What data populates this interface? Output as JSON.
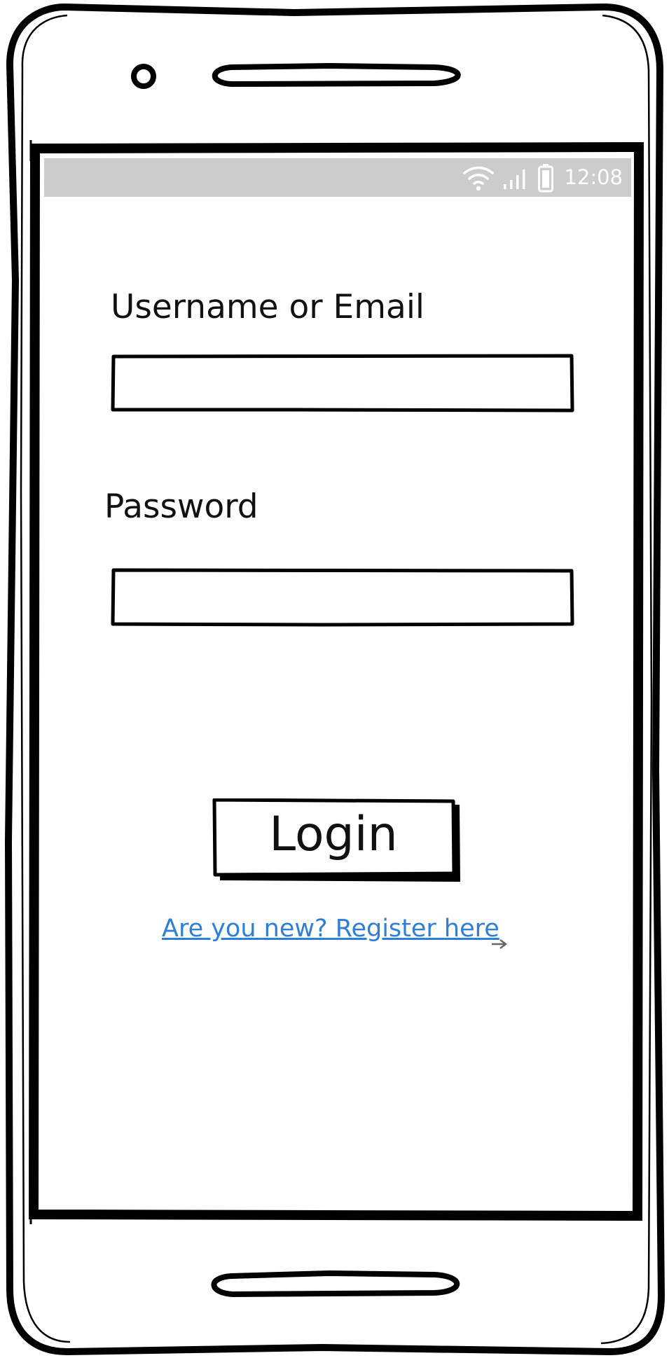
{
  "status_bar": {
    "time": "12:08",
    "icons": [
      "wifi-icon",
      "signal-icon",
      "battery-icon"
    ],
    "background": "#cccccc",
    "text_color": "#ffffff"
  },
  "form": {
    "username_label": "Username or Email",
    "username_value": "",
    "password_label": "Password",
    "password_value": "",
    "login_label": "Login",
    "register_link": "Are you new? Register here",
    "link_color": "#2f7ed8",
    "link_icon": "link-arrow-icon"
  },
  "device": {
    "icons": [
      "front-camera-icon",
      "earpiece-speaker-icon",
      "bottom-speaker-icon"
    ]
  }
}
